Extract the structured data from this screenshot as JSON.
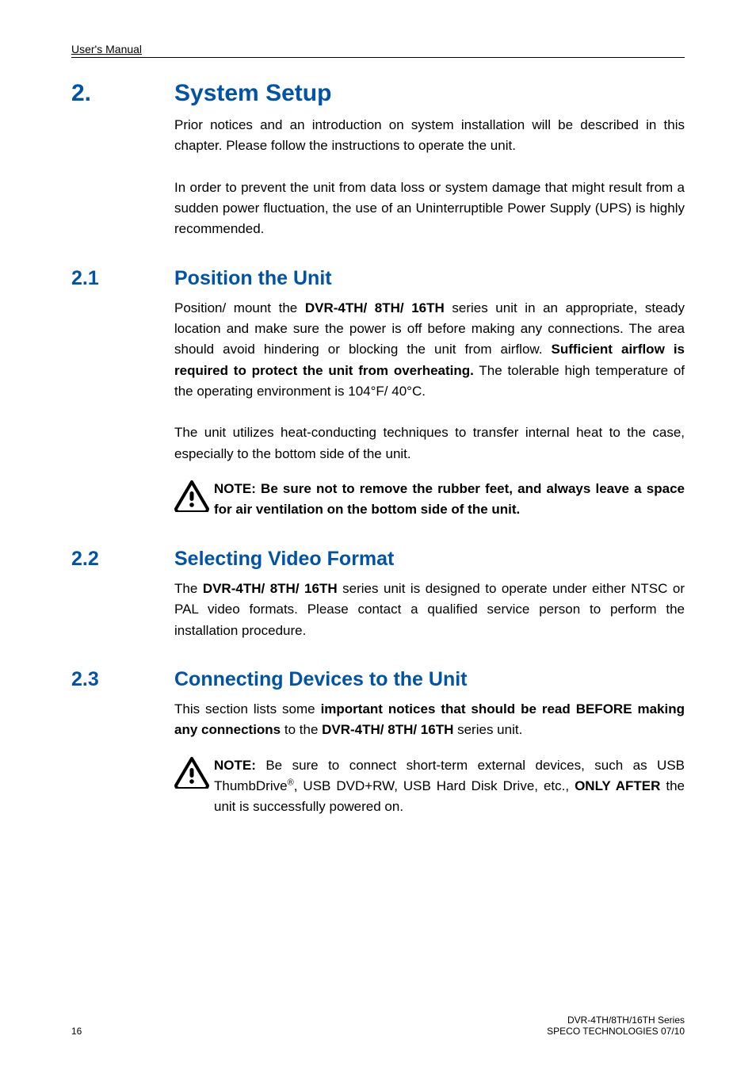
{
  "running_head": "User's Manual",
  "sections": {
    "s2": {
      "num": "2.",
      "title": "System Setup"
    },
    "s21": {
      "num": "2.1",
      "title": "Position the Unit"
    },
    "s22": {
      "num": "2.2",
      "title": "Selecting Video Format"
    },
    "s23": {
      "num": "2.3",
      "title": "Connecting Devices to the Unit"
    }
  },
  "body": {
    "s2p1": "Prior notices and an introduction on system installation will be described in this chapter. Please follow the instructions to operate the unit.",
    "s2p2": "In order to prevent the unit from data loss or system damage that might result from a sudden power fluctuation, the use of an Uninterruptible Power Supply (UPS) is highly recommended.",
    "s21p1_a": "Position/ mount the ",
    "s21p1_b": "DVR-4TH/ 8TH/ 16TH",
    "s21p1_c": " series unit in an appropriate, steady location and make sure the power is off before making any connections. The area should avoid hindering or blocking the unit from airflow. ",
    "s21p1_d": "Sufficient airflow is required to protect the unit from overheating.",
    "s21p1_e": " The tolerable high temperature of the operating environment is 104°F/ 40°C.",
    "s21p2": "The unit utilizes heat-conducting techniques to transfer internal heat to the case, especially to the bottom side of the unit.",
    "s21note": "NOTE: Be sure not to remove the rubber feet, and always leave a space for air ventilation on the bottom side of the unit",
    "s22p1_a": "The ",
    "s22p1_b": "DVR-4TH/ 8TH/ 16TH",
    "s22p1_c": " series unit is designed to operate under either NTSC or PAL video formats. Please contact a qualified service person to perform the installation procedure.",
    "s23p1_a": "This section lists some ",
    "s23p1_b": "important notices that should be read BEFORE making any connections",
    "s23p1_c": " to the ",
    "s23p1_d": "DVR-4TH/ 8TH/ 16TH",
    "s23p1_e": " series unit.",
    "s23note_a": "NOTE:",
    "s23note_b": " Be sure to connect short-term external devices, such as USB ThumbDrive",
    "s23note_sup": "®",
    "s23note_c": ", USB DVD+RW, USB Hard Disk Drive, etc., ",
    "s23note_d": "ONLY AFTER",
    "s23note_e": " the unit is successfully powered on."
  },
  "footer": {
    "page": "16",
    "right1": "DVR-4TH/8TH/16TH Series",
    "right2": "SPECO TECHNOLOGIES 07/10"
  },
  "icons": {
    "warning": "warning-triangle"
  }
}
